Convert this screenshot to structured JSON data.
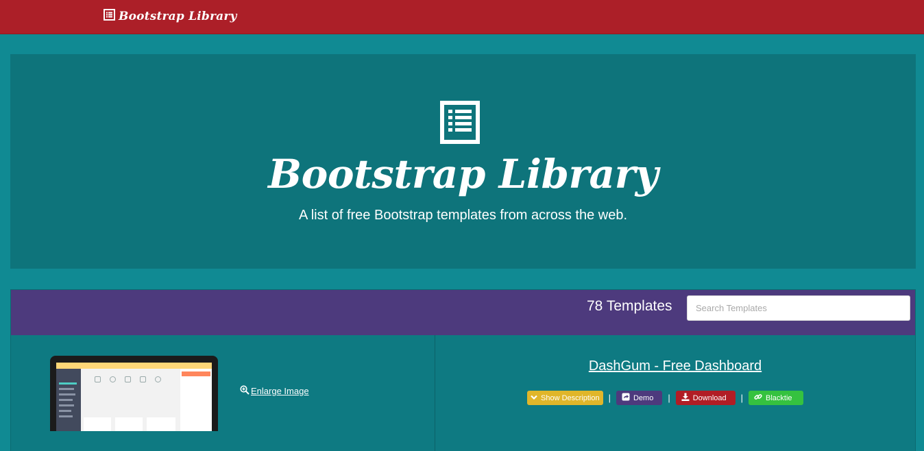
{
  "navbar": {
    "brand": "Bootstrap Library",
    "brand_icon": "list-icon"
  },
  "hero": {
    "icon": "list-icon",
    "title": "Bootstrap Library",
    "subtitle": "A list of free Bootstrap templates from across the web."
  },
  "panel": {
    "count_label": "78 Templates",
    "search_placeholder": "Search Templates"
  },
  "template": {
    "enlarge_label": "Enlarge Image",
    "title": "DashGum - Free Dashboard",
    "actions": {
      "show_description": "Show Description",
      "demo": "Demo",
      "download": "Download",
      "author": "Blacktie"
    },
    "separator": "|"
  },
  "colors": {
    "navbar": "#ac1f28",
    "page": "#108a93",
    "hero": "#0e747b",
    "panel_header": "#4d3a7d",
    "btn_description": "#e0b62a",
    "btn_demo": "#4d3a7d",
    "btn_download": "#b11d25",
    "btn_author": "#35c23f"
  }
}
